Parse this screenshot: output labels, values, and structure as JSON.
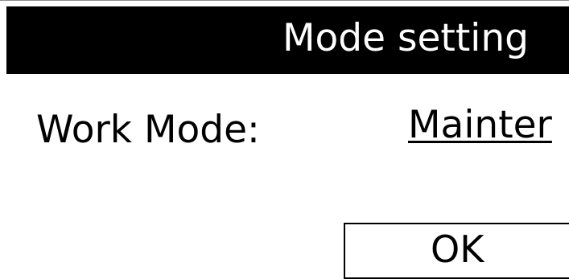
{
  "dialog": {
    "title": "Mode setting",
    "work_mode_label": "Work Mode:",
    "work_mode_value": "Mainter",
    "ok_label": "OK"
  },
  "colors": {
    "title_bar_bg": "#000000",
    "title_text": "#ffffff",
    "body_bg": "#ffffff",
    "text": "#000000"
  }
}
